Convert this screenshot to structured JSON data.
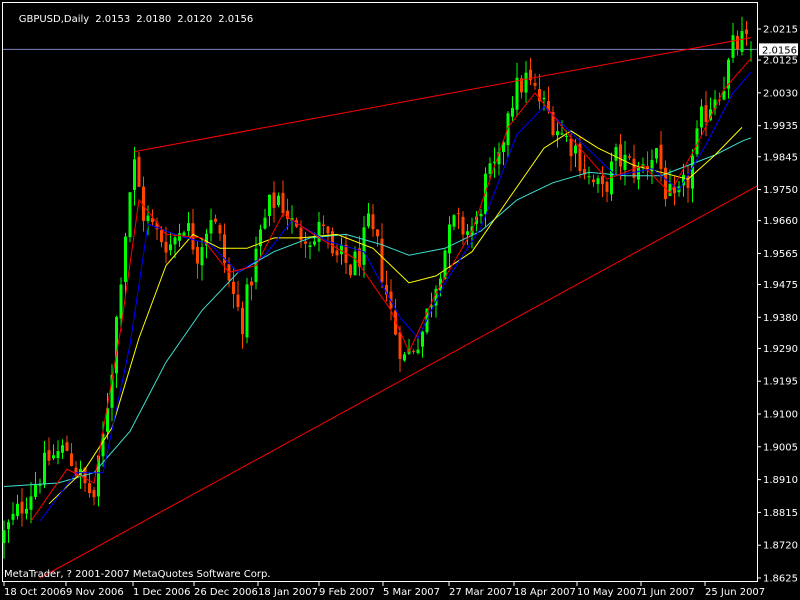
{
  "header": {
    "symbol_timeframe": "GBPUSD,Daily",
    "open": "2.0153",
    "high": "2.0180",
    "low": "2.0120",
    "close": "2.0156"
  },
  "copyright": "MetaTrader, ? 2001-2007 MetaQuotes Software Corp.",
  "current_price_label": "2.0156",
  "colors": {
    "background": "#000000",
    "bull_candle": "#00ff00",
    "bear_candle": "#ff4500",
    "grid": "#ffffff",
    "ma_fast": "#ff0000",
    "ma_medium": "#0000ff",
    "ma_slow": "#ffff00",
    "ma_long": "#40e0d0",
    "trendline": "#ff0000",
    "price_line": "#8080c0"
  },
  "chart_data": {
    "type": "candlestick",
    "symbol": "GBPUSD",
    "timeframe": "Daily",
    "ylim": [
      1.8625,
      2.0215
    ],
    "y_ticks": [
      "2.0215",
      "2.0125",
      "2.0030",
      "1.9935",
      "1.9845",
      "1.9750",
      "1.9660",
      "1.9565",
      "1.9475",
      "1.9380",
      "1.9290",
      "1.9195",
      "1.9100",
      "1.9005",
      "1.8910",
      "1.8815",
      "1.8720",
      "1.8625"
    ],
    "x_ticks": [
      "18 Oct 2006",
      "9 Nov 2006",
      "1 Dec 2006",
      "26 Dec 2006",
      "18 Jan 2007",
      "9 Feb 2007",
      "5 Mar 2007",
      "27 Mar 2007",
      "18 Apr 2007",
      "10 May 2007",
      "1 Jun 2007",
      "25 Jun 2007"
    ],
    "current_price": 2.0156,
    "close_path": [
      [
        0,
        1.875
      ],
      [
        6,
        1.888
      ],
      [
        10,
        1.897
      ],
      [
        14,
        1.9
      ],
      [
        16,
        1.894
      ],
      [
        18,
        1.889
      ],
      [
        20,
        1.886
      ],
      [
        22,
        1.903
      ],
      [
        24,
        1.924
      ],
      [
        26,
        1.951
      ],
      [
        28,
        1.975
      ],
      [
        29,
        1.982
      ],
      [
        31,
        1.968
      ],
      [
        34,
        1.962
      ],
      [
        37,
        1.959
      ],
      [
        40,
        1.966
      ],
      [
        43,
        1.957
      ],
      [
        46,
        1.968
      ],
      [
        48,
        1.96
      ],
      [
        50,
        1.948
      ],
      [
        52,
        1.94
      ],
      [
        53,
        1.937
      ],
      [
        55,
        1.95
      ],
      [
        57,
        1.962
      ],
      [
        59,
        1.97
      ],
      [
        61,
        1.973
      ],
      [
        63,
        1.968
      ],
      [
        65,
        1.962
      ],
      [
        67,
        1.963
      ],
      [
        69,
        1.96
      ],
      [
        71,
        1.966
      ],
      [
        73,
        1.954
      ],
      [
        75,
        1.955
      ],
      [
        77,
        1.952
      ],
      [
        79,
        1.956
      ],
      [
        81,
        1.964
      ],
      [
        83,
        1.958
      ],
      [
        85,
        1.945
      ],
      [
        87,
        1.934
      ],
      [
        89,
        1.926
      ],
      [
        91,
        1.93
      ],
      [
        93,
        1.934
      ],
      [
        95,
        1.944
      ],
      [
        98,
        1.958
      ],
      [
        100,
        1.965
      ],
      [
        103,
        1.963
      ],
      [
        105,
        1.965
      ],
      [
        107,
        1.977
      ],
      [
        110,
        1.982
      ],
      [
        112,
        1.999
      ],
      [
        114,
        2.004
      ],
      [
        116,
        2.007
      ],
      [
        118,
        2.003
      ],
      [
        121,
        1.997
      ],
      [
        124,
        1.991
      ],
      [
        127,
        1.987
      ],
      [
        130,
        1.978
      ],
      [
        133,
        1.974
      ],
      [
        136,
        1.984
      ],
      [
        138,
        1.983
      ],
      [
        141,
        1.98
      ],
      [
        143,
        1.983
      ],
      [
        145,
        1.987
      ],
      [
        147,
        1.975
      ],
      [
        149,
        1.97
      ],
      [
        152,
        1.978
      ],
      [
        155,
        1.995
      ],
      [
        158,
        2.003
      ],
      [
        160,
        2.006
      ],
      [
        162,
        2.016
      ],
      [
        164,
        2.018
      ],
      [
        166,
        2.0156
      ]
    ],
    "ma_fast_path": [
      [
        6,
        1.879
      ],
      [
        14,
        1.894
      ],
      [
        20,
        1.89
      ],
      [
        26,
        1.935
      ],
      [
        30,
        1.972
      ],
      [
        36,
        1.962
      ],
      [
        44,
        1.961
      ],
      [
        50,
        1.951
      ],
      [
        56,
        1.953
      ],
      [
        62,
        1.968
      ],
      [
        70,
        1.961
      ],
      [
        78,
        1.955
      ],
      [
        86,
        1.94
      ],
      [
        90,
        1.928
      ],
      [
        96,
        1.945
      ],
      [
        104,
        1.963
      ],
      [
        112,
        1.993
      ],
      [
        118,
        2.003
      ],
      [
        126,
        1.99
      ],
      [
        134,
        1.978
      ],
      [
        142,
        1.982
      ],
      [
        148,
        1.974
      ],
      [
        154,
        1.988
      ],
      [
        160,
        2.004
      ],
      [
        166,
        2.013
      ]
    ],
    "ma_medium_path": [
      [
        8,
        1.879
      ],
      [
        16,
        1.893
      ],
      [
        22,
        1.893
      ],
      [
        28,
        1.93
      ],
      [
        32,
        1.965
      ],
      [
        38,
        1.962
      ],
      [
        46,
        1.959
      ],
      [
        52,
        1.951
      ],
      [
        58,
        1.956
      ],
      [
        64,
        1.966
      ],
      [
        72,
        1.96
      ],
      [
        80,
        1.957
      ],
      [
        88,
        1.938
      ],
      [
        92,
        1.932
      ],
      [
        98,
        1.948
      ],
      [
        106,
        1.964
      ],
      [
        114,
        1.991
      ],
      [
        120,
        1.999
      ],
      [
        128,
        1.989
      ],
      [
        136,
        1.979
      ],
      [
        144,
        1.981
      ],
      [
        150,
        1.975
      ],
      [
        156,
        1.988
      ],
      [
        162,
        2.003
      ],
      [
        166,
        2.009
      ]
    ],
    "ma_slow_path": [
      [
        10,
        1.884
      ],
      [
        18,
        1.894
      ],
      [
        24,
        1.906
      ],
      [
        30,
        1.932
      ],
      [
        36,
        1.953
      ],
      [
        42,
        1.962
      ],
      [
        48,
        1.958
      ],
      [
        54,
        1.958
      ],
      [
        60,
        1.961
      ],
      [
        66,
        1.961
      ],
      [
        74,
        1.962
      ],
      [
        82,
        1.958
      ],
      [
        90,
        1.948
      ],
      [
        96,
        1.95
      ],
      [
        104,
        1.957
      ],
      [
        112,
        1.972
      ],
      [
        120,
        1.987
      ],
      [
        126,
        1.992
      ],
      [
        132,
        1.987
      ],
      [
        140,
        1.982
      ],
      [
        146,
        1.98
      ],
      [
        152,
        1.978
      ],
      [
        158,
        1.985
      ],
      [
        164,
        1.993
      ]
    ],
    "ma_long_path": [
      [
        0,
        1.889
      ],
      [
        12,
        1.89
      ],
      [
        20,
        1.893
      ],
      [
        28,
        1.905
      ],
      [
        36,
        1.925
      ],
      [
        44,
        1.94
      ],
      [
        52,
        1.951
      ],
      [
        60,
        1.957
      ],
      [
        68,
        1.961
      ],
      [
        76,
        1.962
      ],
      [
        84,
        1.959
      ],
      [
        90,
        1.956
      ],
      [
        98,
        1.958
      ],
      [
        106,
        1.963
      ],
      [
        114,
        1.972
      ],
      [
        122,
        1.977
      ],
      [
        130,
        1.98
      ],
      [
        138,
        1.979
      ],
      [
        146,
        1.979
      ],
      [
        152,
        1.982
      ],
      [
        158,
        1.985
      ],
      [
        164,
        1.989
      ],
      [
        166,
        1.99
      ]
    ],
    "upper_trendline": [
      [
        29,
        1.986
      ],
      [
        166,
        2.019
      ]
    ],
    "lower_trendline": [
      [
        8,
        1.8625
      ],
      [
        169,
        1.976
      ]
    ]
  }
}
